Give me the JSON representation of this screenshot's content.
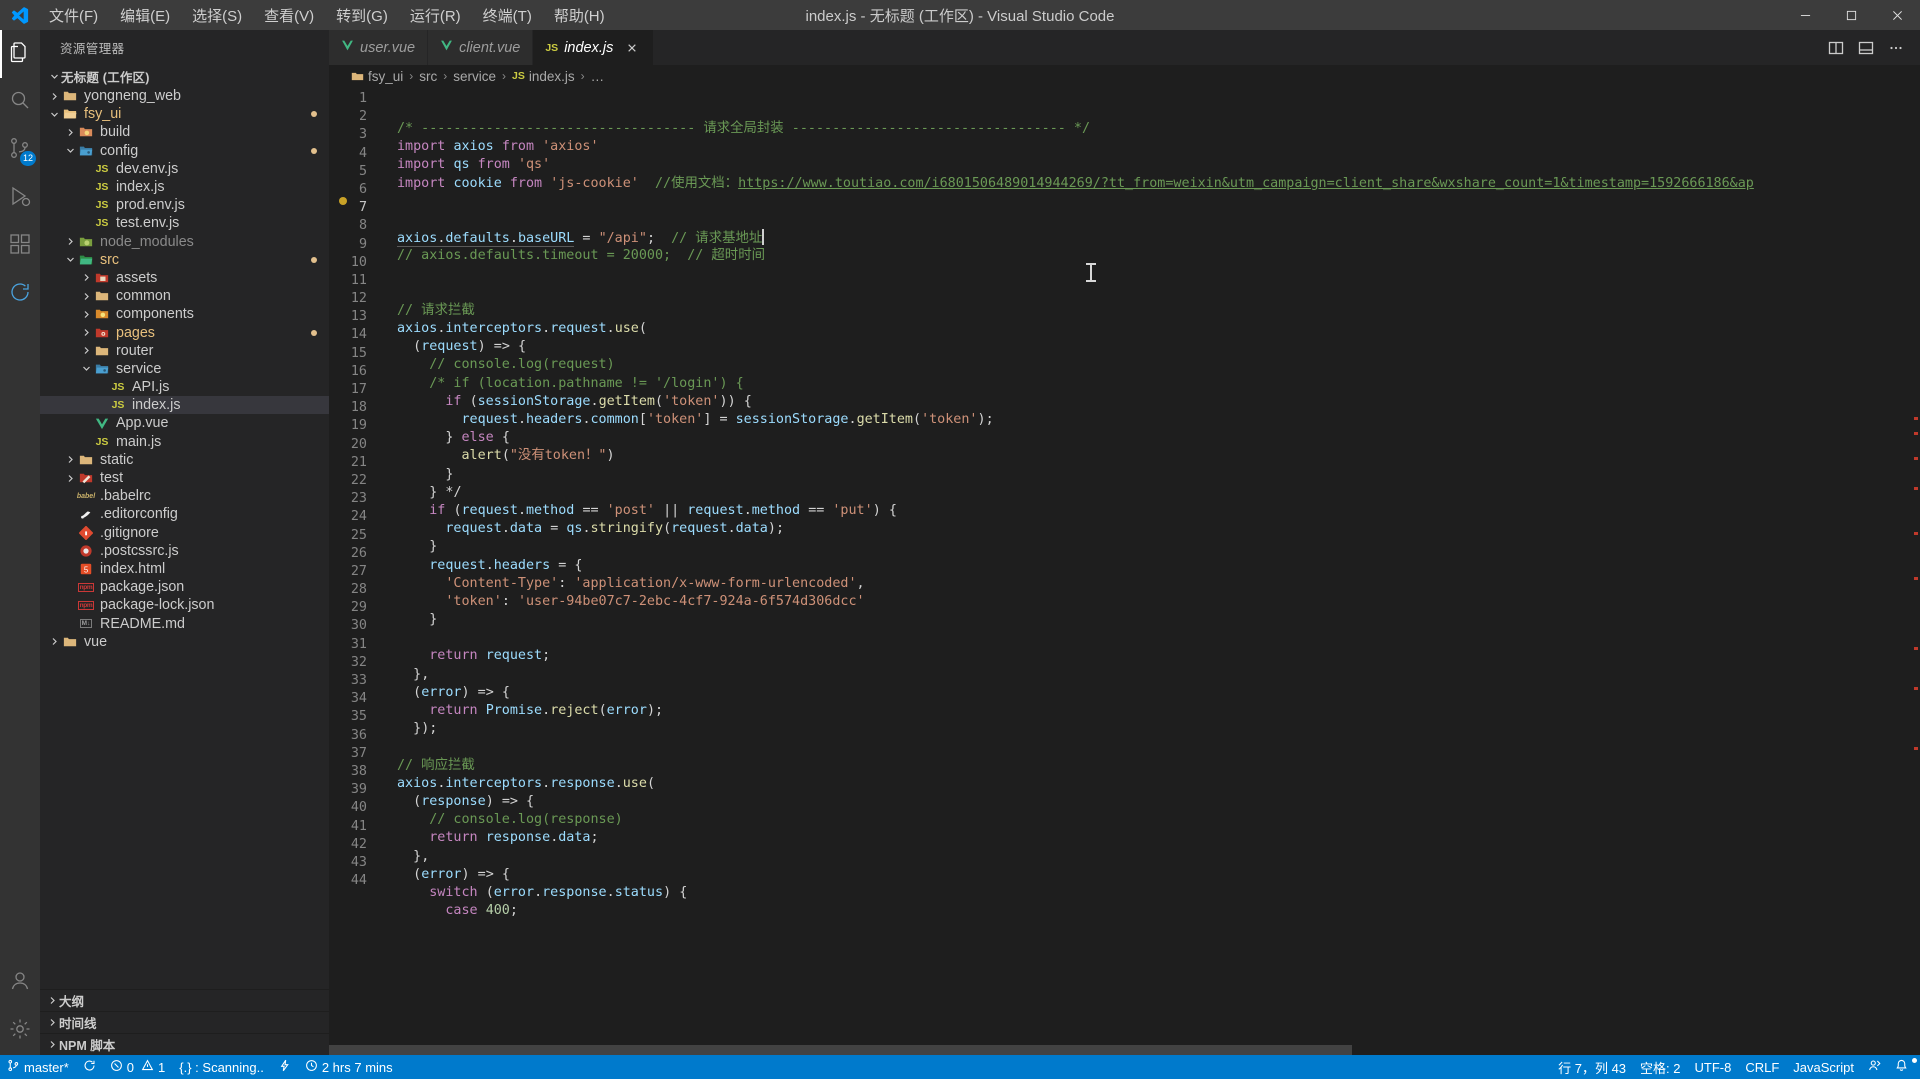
{
  "titlebar": {
    "logo_icon": "vscode-logo-icon",
    "menus": [
      "文件(F)",
      "编辑(E)",
      "选择(S)",
      "查看(V)",
      "转到(G)",
      "运行(R)",
      "终端(T)",
      "帮助(H)"
    ],
    "window_title": "index.js - 无标题 (工作区) - Visual Studio Code",
    "minimize_icon": "minimize-icon",
    "maximize_icon": "maximize-icon",
    "close_icon": "close-icon"
  },
  "activitybar": {
    "items": [
      {
        "name": "explorer",
        "icon": "files-icon",
        "badge": ""
      },
      {
        "name": "search",
        "icon": "search-icon",
        "badge": ""
      },
      {
        "name": "source-control",
        "icon": "source-control-icon",
        "badge": "12"
      },
      {
        "name": "run-and-debug",
        "icon": "debug-icon",
        "badge": ""
      },
      {
        "name": "extensions",
        "icon": "extensions-icon",
        "badge": ""
      },
      {
        "name": "sync",
        "icon": "sync-icon",
        "badge": ""
      }
    ],
    "bottom": [
      {
        "name": "accounts",
        "icon": "account-icon"
      },
      {
        "name": "settings",
        "icon": "gear-icon"
      }
    ]
  },
  "sidebar": {
    "title": "资源管理器",
    "workspace": "无标题 (工作区)",
    "tree": [
      {
        "label": "yongneng_web",
        "indent": 1,
        "chev": "right",
        "icon": "folder-tan",
        "modified": false
      },
      {
        "label": "fsy_ui",
        "indent": 1,
        "chev": "down",
        "icon": "folder-tan-open",
        "modified": true,
        "color": "gold"
      },
      {
        "label": "build",
        "indent": 2,
        "chev": "right",
        "icon": "folder-build",
        "modified": false
      },
      {
        "label": "config",
        "indent": 2,
        "chev": "down",
        "icon": "folder-config-open",
        "modified": true
      },
      {
        "label": "dev.env.js",
        "indent": 3,
        "chev": "none",
        "icon": "js-file",
        "modified": false
      },
      {
        "label": "index.js",
        "indent": 3,
        "chev": "none",
        "icon": "js-file",
        "modified": false
      },
      {
        "label": "prod.env.js",
        "indent": 3,
        "chev": "none",
        "icon": "js-file",
        "modified": false
      },
      {
        "label": "test.env.js",
        "indent": 3,
        "chev": "none",
        "icon": "js-file",
        "modified": false
      },
      {
        "label": "node_modules",
        "indent": 2,
        "chev": "right",
        "icon": "folder-node",
        "modified": false,
        "color": "dim"
      },
      {
        "label": "src",
        "indent": 2,
        "chev": "down",
        "icon": "folder-src-open",
        "modified": true,
        "color": "gold"
      },
      {
        "label": "assets",
        "indent": 3,
        "chev": "right",
        "icon": "folder-assets",
        "modified": false
      },
      {
        "label": "common",
        "indent": 3,
        "chev": "right",
        "icon": "folder-tan",
        "modified": false
      },
      {
        "label": "components",
        "indent": 3,
        "chev": "right",
        "icon": "folder-components",
        "modified": false
      },
      {
        "label": "pages",
        "indent": 3,
        "chev": "right",
        "icon": "folder-pages",
        "modified": true,
        "color": "gold"
      },
      {
        "label": "router",
        "indent": 3,
        "chev": "right",
        "icon": "folder-tan",
        "modified": false
      },
      {
        "label": "service",
        "indent": 3,
        "chev": "down",
        "icon": "folder-config-open",
        "modified": false
      },
      {
        "label": "API.js",
        "indent": 4,
        "chev": "none",
        "icon": "js-file",
        "modified": false
      },
      {
        "label": "index.js",
        "indent": 4,
        "chev": "none",
        "icon": "js-file",
        "modified": false,
        "selected": true
      },
      {
        "label": "App.vue",
        "indent": 3,
        "chev": "none",
        "icon": "vue-file",
        "modified": false
      },
      {
        "label": "main.js",
        "indent": 3,
        "chev": "none",
        "icon": "js-file",
        "modified": false
      },
      {
        "label": "static",
        "indent": 2,
        "chev": "right",
        "icon": "folder-tan",
        "modified": false
      },
      {
        "label": "test",
        "indent": 2,
        "chev": "right",
        "icon": "folder-test",
        "modified": false
      },
      {
        "label": ".babelrc",
        "indent": 2,
        "chev": "none",
        "icon": "babel-file",
        "modified": false
      },
      {
        "label": ".editorconfig",
        "indent": 2,
        "chev": "none",
        "icon": "editorconfig-file",
        "modified": false
      },
      {
        "label": ".gitignore",
        "indent": 2,
        "chev": "none",
        "icon": "git-file",
        "modified": false
      },
      {
        "label": ".postcssrc.js",
        "indent": 2,
        "chev": "none",
        "icon": "postcss-file",
        "modified": false
      },
      {
        "label": "index.html",
        "indent": 2,
        "chev": "none",
        "icon": "html-file",
        "modified": false
      },
      {
        "label": "package.json",
        "indent": 2,
        "chev": "none",
        "icon": "npm-file",
        "modified": false
      },
      {
        "label": "package-lock.json",
        "indent": 2,
        "chev": "none",
        "icon": "npm-file",
        "modified": false
      },
      {
        "label": "README.md",
        "indent": 2,
        "chev": "none",
        "icon": "md-file",
        "modified": false
      },
      {
        "label": "vue",
        "indent": 1,
        "chev": "right",
        "icon": "folder-tan",
        "modified": false
      }
    ],
    "sections": [
      {
        "label": "大纲"
      },
      {
        "label": "时间线"
      },
      {
        "label": "NPM 脚本"
      }
    ]
  },
  "tabs": [
    {
      "label": "user.vue",
      "icon": "vue-icon",
      "active": false,
      "italic": true
    },
    {
      "label": "client.vue",
      "icon": "vue-icon",
      "active": false,
      "italic": true
    },
    {
      "label": "index.js",
      "icon": "js-icon",
      "active": true,
      "italic": true,
      "close_icon": "close-icon"
    }
  ],
  "tabs_actions": [
    {
      "name": "split-editor-right",
      "icon": "split-editor-icon"
    },
    {
      "name": "toggle-panel",
      "icon": "layout-panel-icon"
    },
    {
      "name": "more-actions",
      "icon": "ellipsis-icon"
    }
  ],
  "breadcrumb": [
    {
      "label": "fsy_ui",
      "icon": "folder-icon"
    },
    {
      "label": "src",
      "icon": ""
    },
    {
      "label": "service",
      "icon": ""
    },
    {
      "label": "index.js",
      "icon": "js-icon"
    },
    {
      "label": "…",
      "icon": ""
    }
  ],
  "editor": {
    "first_line": 1,
    "last_line": 44,
    "breakpoint_glyph_line": 2,
    "lines": [
      "/* ---------------------------------- 请求全局封装 ---------------------------------- */",
      "import axios from 'axios'",
      "import qs from 'qs'",
      "import cookie from 'js-cookie'  //使用文档：https://www.toutiao.com/i6801506489014944269/?tt_from=weixin&utm_campaign=client_share&wxshare_count=1&timestamp=1592666186&ap",
      "",
      "",
      "axios.defaults.baseURL = \"/api\";  // 请求基地址",
      "// axios.defaults.timeout = 20000;  // 超时时间",
      "",
      "",
      "// 请求拦截",
      "axios.interceptors.request.use(",
      "  (request) => {",
      "    // console.log(request)",
      "    /* if (location.pathname != '/login') {",
      "      if (sessionStorage.getItem('token')) {",
      "        request.headers.common['token'] = sessionStorage.getItem('token');",
      "      } else {",
      "        alert(\"没有token！\")",
      "      }",
      "    } */",
      "    if (request.method == 'post' || request.method == 'put') {",
      "      request.data = qs.stringify(request.data);",
      "    }",
      "    request.headers = {",
      "      'Content-Type': 'application/x-www-form-urlencoded',",
      "      'token': 'user-94be07c7-2ebc-4cf7-924a-6f574d306dcc'",
      "    }",
      "",
      "    return request;",
      "  },",
      "  (error) => {",
      "    return Promise.reject(error);",
      "  });",
      "",
      "// 响应拦截",
      "axios.interceptors.response.use(",
      "  (response) => {",
      "    // console.log(response)",
      "    return response.data;",
      "  },",
      "  (error) => {",
      "    switch (error.response.status) {",
      "      case 400;"
    ]
  },
  "statusbar": {
    "left": [
      {
        "name": "branch",
        "icon": "source-control-icon",
        "label": "master*"
      },
      {
        "name": "sync-changes",
        "icon": "sync-icon",
        "label": ""
      },
      {
        "name": "problems",
        "icon": "error-warning-icon",
        "label": "0  1",
        "errors": "0",
        "warnings": "1"
      },
      {
        "name": "tslint",
        "icon": "braces-icon",
        "label": "{.} : Scanning.."
      },
      {
        "name": "live-share",
        "icon": "bolt-icon",
        "label": ""
      },
      {
        "name": "time-tracker",
        "icon": "clock-icon",
        "label": "2 hrs 7 mins"
      }
    ],
    "right": [
      {
        "name": "cursor-position",
        "label": "行 7，列 43"
      },
      {
        "name": "indentation",
        "label": "空格: 2"
      },
      {
        "name": "encoding",
        "label": "UTF-8"
      },
      {
        "name": "eol",
        "label": "CRLF"
      },
      {
        "name": "language-mode",
        "label": "JavaScript"
      },
      {
        "name": "feedback",
        "icon": "feedback-icon",
        "label": ""
      },
      {
        "name": "notifications",
        "icon": "bell-icon",
        "label": ""
      }
    ]
  },
  "colors": {
    "accent": "#007acc",
    "titlebar_bg": "#3c3c3c",
    "sidebar_bg": "#252526",
    "editor_bg": "#1e1e1e",
    "activitybar_bg": "#333333"
  }
}
